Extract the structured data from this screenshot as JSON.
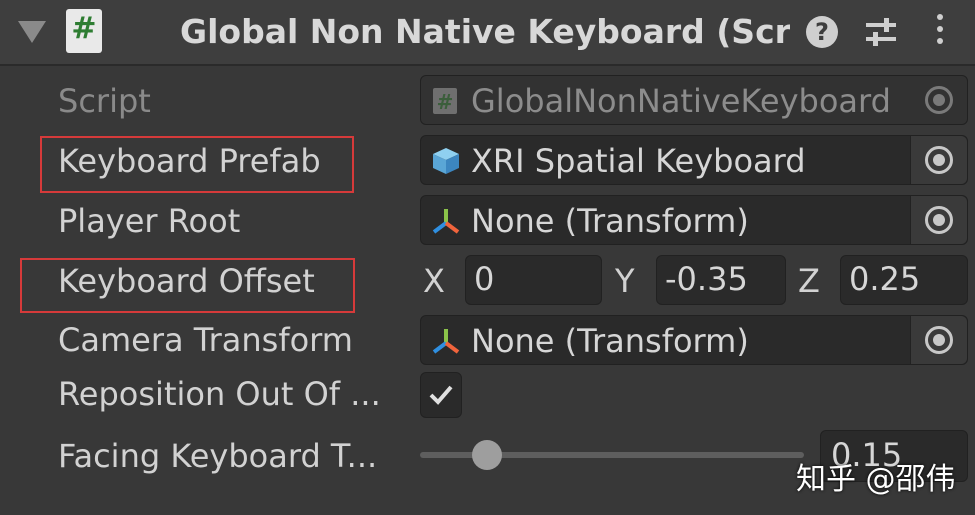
{
  "header": {
    "title": "Global Non Native Keyboard (Scrip",
    "script_badge": "#",
    "help_glyph": "?"
  },
  "rows": {
    "script": {
      "label": "Script",
      "value": "GlobalNonNativeKeyboard",
      "icon": "hash-script-icon"
    },
    "keyboard_prefab": {
      "label": "Keyboard Prefab",
      "value": "XRI Spatial Keyboard",
      "icon": "prefab-cube-icon"
    },
    "player_root": {
      "label": "Player Root",
      "value": "None (Transform)",
      "icon": "transform-axis-icon"
    },
    "keyboard_offset": {
      "label": "Keyboard Offset",
      "x_label": "X",
      "x": "0",
      "y_label": "Y",
      "y": "-0.35",
      "z_label": "Z",
      "z": "0.25"
    },
    "camera_transform": {
      "label": "Camera Transform",
      "value": "None (Transform)",
      "icon": "transform-axis-icon"
    },
    "reposition": {
      "label": "Reposition Out Of ...",
      "checked": true
    },
    "facing": {
      "label": "Facing Keyboard T...",
      "value": "0.15",
      "slider_fraction": 0.18
    }
  },
  "watermark": "知乎 @邵伟",
  "colors": {
    "background": "#383838",
    "field": "#2a2a2a",
    "highlight": "#d63a3a",
    "script_green": "#2e7d32"
  }
}
